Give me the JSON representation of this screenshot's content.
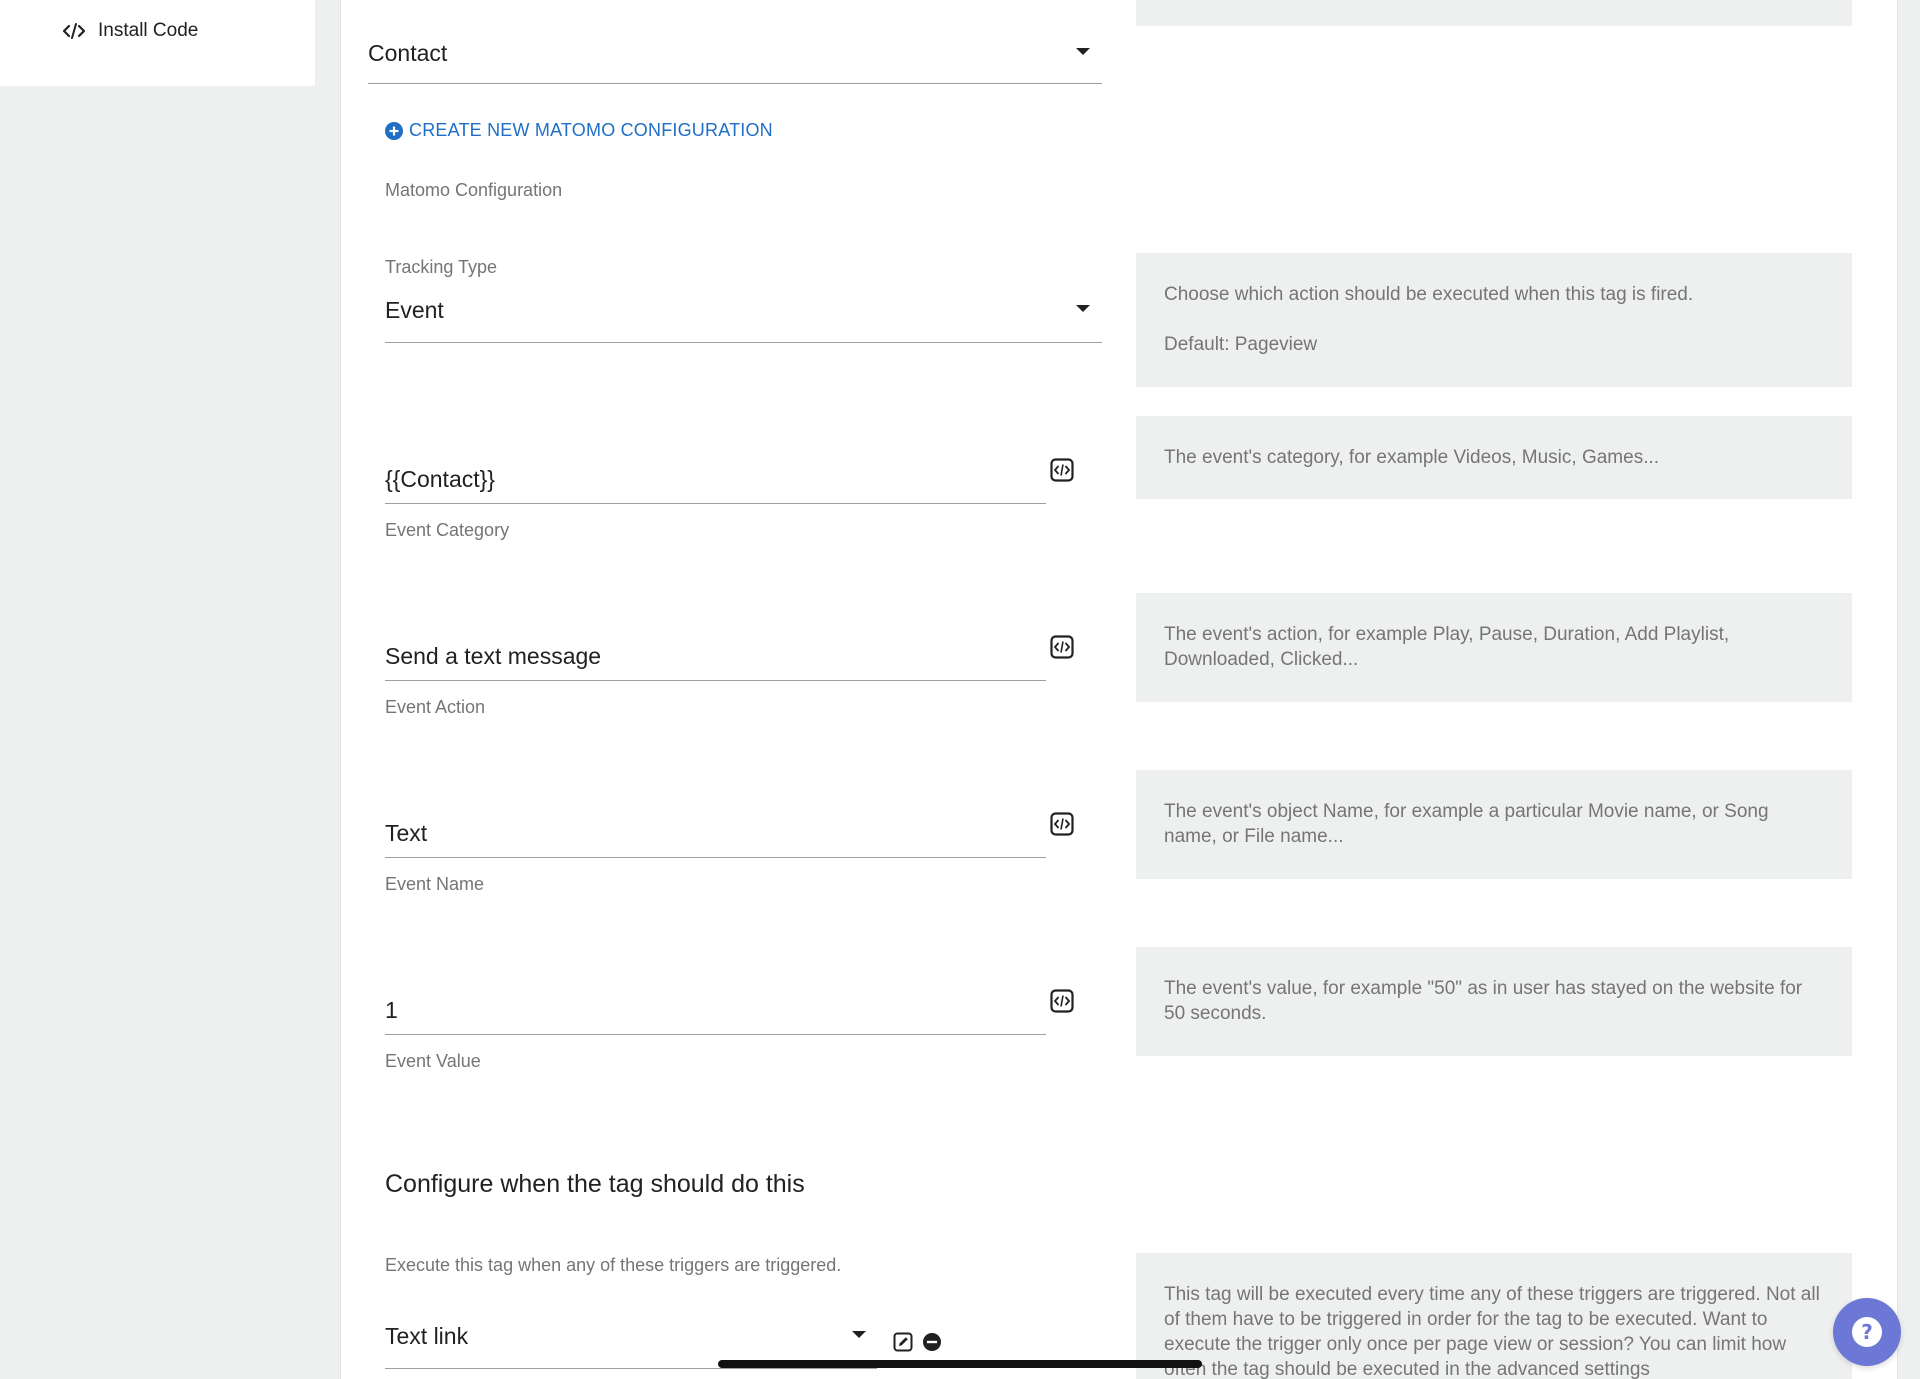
{
  "sidebar": {
    "install_code": {
      "label": "Install Code",
      "icon": "code-icon"
    }
  },
  "config_select": {
    "value": "Contact"
  },
  "create_link": {
    "label": "CREATE NEW MATOMO CONFIGURATION",
    "icon": "plus-circle-icon"
  },
  "config_label": "Matomo Configuration",
  "tracking_type": {
    "label": "Tracking Type",
    "value": "Event",
    "help_line1": "Choose which action should be executed when this tag is fired.",
    "help_line2": "Default: Pageview"
  },
  "event_category": {
    "value": "{{Contact}}",
    "label": "Event Category",
    "help": "The event's category, for example Videos, Music, Games..."
  },
  "event_action": {
    "value": "Send a text message",
    "label": "Event Action",
    "help": "The event's action, for example Play, Pause, Duration, Add Playlist, Downloaded, Clicked..."
  },
  "event_name": {
    "value": "Text",
    "label": "Event Name",
    "help": "The event's object Name, for example a particular Movie name, or Song name, or File name..."
  },
  "event_value": {
    "value": "1",
    "label": "Event Value",
    "help": "The event's value, for example \"50\" as in user has stayed on the website for 50 seconds."
  },
  "triggers": {
    "heading": "Configure when the tag should do this",
    "description": "Execute this tag when any of these triggers are triggered.",
    "value": "Text link",
    "help": "This tag will be executed every time any of these triggers are triggered. Not all of them have to be triggered in order for the tag to be executed. Want to execute the trigger only once per page view or session? You can limit how often the tag should be executed in the advanced settings"
  },
  "colors": {
    "link": "#1f6fc6",
    "help_bg": "#eef0ef",
    "fab": "#6d78d6"
  }
}
